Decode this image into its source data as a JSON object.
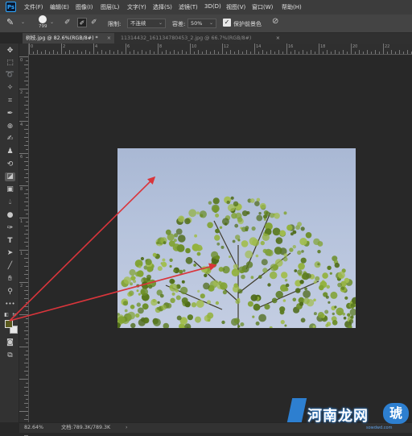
{
  "app": {
    "logo_text": "Ps"
  },
  "menu": [
    "文件(F)",
    "编辑(E)",
    "图像(I)",
    "图层(L)",
    "文字(Y)",
    "选择(S)",
    "滤镜(T)",
    "3D(D)",
    "视图(V)",
    "窗口(W)",
    "帮助(H)"
  ],
  "options": {
    "brush_size": "799",
    "limits_label": "限制:",
    "limits_value": "不连续",
    "tolerance_label": "容差:",
    "tolerance_value": "50%",
    "protect_fg_label": "保护前景色",
    "protect_fg_checked": true
  },
  "tabs": [
    {
      "label": "树枝.jpg @ 82.6%(RGB/8#) *",
      "active": true
    },
    {
      "label": "11314432_161134780453_2.jpg @ 66.7%(RGB/8#)",
      "active": false
    }
  ],
  "ruler_h_labels": [
    "0",
    "2",
    "4",
    "6",
    "8",
    "10",
    "12",
    "14",
    "16",
    "18",
    "20",
    "22"
  ],
  "ruler_v_labels": [
    "0",
    "2",
    "4",
    "6",
    "8",
    "1",
    "1",
    "2"
  ],
  "status": {
    "zoom": "82.64%",
    "doc_info": "文档:789.3K/789.3K"
  },
  "colors": {
    "foreground": "#5a5a1e",
    "background": "#e8e8e8",
    "annotation_arrow": "#d9353b",
    "sky": "#b3c1da",
    "tree": "#6a8a2a"
  },
  "watermark": {
    "text": "河南龙网",
    "tag": "琥",
    "url": "sowdwd.com"
  }
}
